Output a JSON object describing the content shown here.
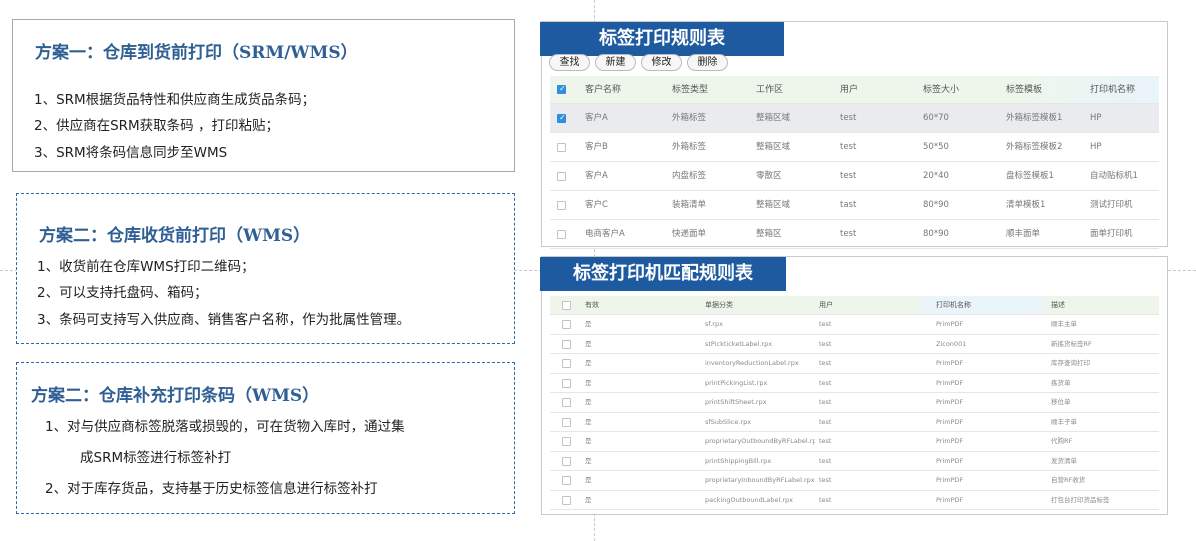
{
  "plans": [
    {
      "title": "方案一：仓库到货前打印（SRM/WMS）",
      "lines": [
        "1、SRM根据货品特性和供应商生成货品条码；",
        "2、供应商在SRM获取条码 ，打印粘贴；",
        "3、SRM将条码信息同步至WMS"
      ]
    },
    {
      "title": "方案二：仓库收货前打印（WMS）",
      "lines": [
        "1、收货前在仓库WMS打印二维码；",
        "2、可以支持托盘码、箱码；",
        "3、条码可支持写入供应商、销售客户名称，作为批属性管理。"
      ]
    },
    {
      "title": "方案二：仓库补充打印条码（WMS）",
      "lines": [
        "1、对与供应商标签脱落或损毁的，可在货物入库时，通过集",
        "成SRM标签进行标签补打",
        "2、对于库存货品，支持基于历史标签信息进行标签补打"
      ]
    }
  ],
  "rules_panel": {
    "title": "标签打印规则表",
    "buttons": [
      "查找",
      "新建",
      "修改",
      "删除"
    ],
    "columns": [
      "客户名称",
      "标签类型",
      "工作区",
      "用户",
      "标签大小",
      "标签模板",
      "打印机名称"
    ],
    "rows": [
      {
        "checked": true,
        "cells": [
          "客户A",
          "外箱标签",
          "整箱区域",
          "test",
          "60*70",
          "外箱标签模板1",
          "HP"
        ]
      },
      {
        "checked": false,
        "cells": [
          "客户B",
          "外箱标签",
          "整箱区域",
          "test",
          "50*50",
          "外箱标签模板2",
          "HP"
        ]
      },
      {
        "checked": false,
        "cells": [
          "客户A",
          "内盘标签",
          "零散区",
          "test",
          "20*40",
          "盘标签模板1",
          "自动贴标机1"
        ]
      },
      {
        "checked": false,
        "cells": [
          "客户C",
          "装箱清单",
          "整箱区域",
          "tast",
          "80*90",
          "清单模板1",
          "测试打印机"
        ]
      },
      {
        "checked": false,
        "cells": [
          "电商客户A",
          "快递面单",
          "整箱区",
          "test",
          "80*90",
          "顺丰面单",
          "面单打印机"
        ]
      }
    ]
  },
  "printer_panel": {
    "title": "标签打印机匹配规则表",
    "columns": [
      "有效",
      "单据分类",
      "用户",
      "打印机名称",
      "描述"
    ],
    "rows": [
      [
        "是",
        "sf.rpx",
        "test",
        "PrimPDF",
        "顺丰主单"
      ],
      [
        "是",
        "stPickticketLabel.rpx",
        "test",
        "Zicon001",
        "新拣货标签RF"
      ],
      [
        "是",
        "inventoryReductionLabel.rpx",
        "test",
        "PrimPDF",
        "库存查询打印"
      ],
      [
        "是",
        "printPickingList.rpx",
        "test",
        "PrimPDF",
        "拣货单"
      ],
      [
        "是",
        "printShiftSheet.rpx",
        "test",
        "PrimPDF",
        "移位单"
      ],
      [
        "是",
        "sfSubSlice.rpx",
        "test",
        "PrimPDF",
        "顺丰子单"
      ],
      [
        "是",
        "proprietaryOutboundByRFLabel.rpx",
        "test",
        "PrimPDF",
        "代购RF"
      ],
      [
        "是",
        "printShippingBill.rpx",
        "test",
        "PrimPDF",
        "发货清单"
      ],
      [
        "是",
        "proprietaryInboundByRFLabel.rpx",
        "test",
        "PrimPDF",
        "自营RF收货"
      ],
      [
        "是",
        "packingOutboundLabel.rpx",
        "test",
        "PrimPDF",
        "打包台打印货品标签"
      ]
    ]
  },
  "colors": {
    "plan_title": "#2f5f94",
    "panel_title_bg": "#1e5aa0",
    "header_bg_green": "#eef6ec",
    "header_bg_blue": "#e9f4fb",
    "selected_row": "#e9ebef",
    "checkbox_on": "#2f8ee0"
  }
}
